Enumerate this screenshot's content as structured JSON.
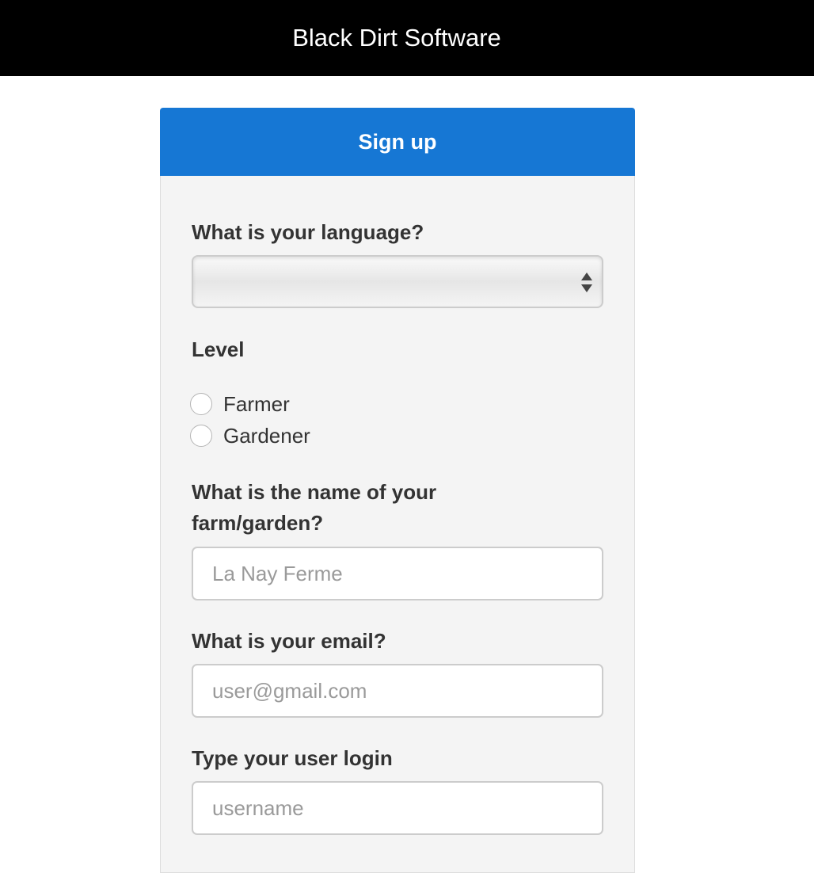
{
  "header": {
    "brand": "Black Dirt Software"
  },
  "form": {
    "title": "Sign up",
    "language": {
      "label": "What is your language?",
      "selected": ""
    },
    "level": {
      "label": "Level",
      "options": [
        "Farmer",
        "Gardener"
      ]
    },
    "farm_name": {
      "label_line1": "What is the name of your",
      "label_line2": "farm/garden?",
      "placeholder": "La Nay Ferme",
      "value": ""
    },
    "email": {
      "label": "What is your email?",
      "placeholder": "user@gmail.com",
      "value": ""
    },
    "login": {
      "label": "Type your user login",
      "placeholder": "username",
      "value": ""
    }
  },
  "colors": {
    "topbar": "#000000",
    "accent": "#1677d4",
    "card_bg": "#f4f4f4"
  }
}
